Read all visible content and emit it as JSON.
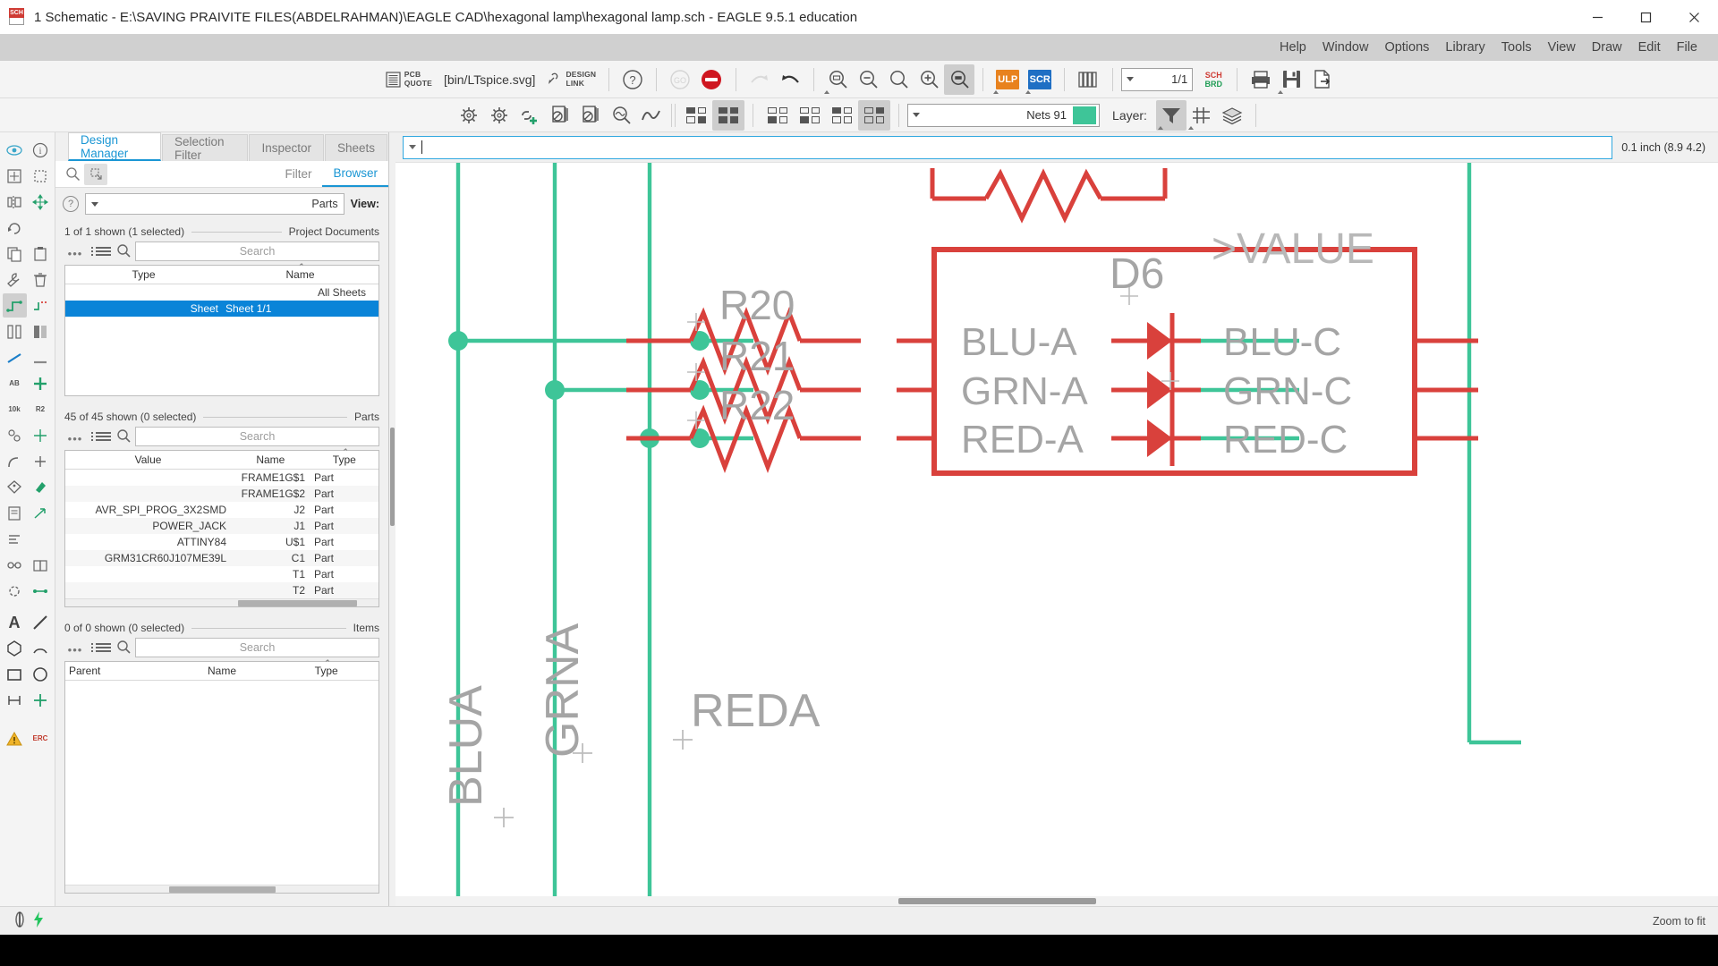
{
  "window": {
    "title": "1 Schematic - E:\\SAVING PRAIVITE FILES(ABDELRAHMAN)\\EAGLE CAD\\hexagonal lamp\\hexagonal lamp.sch - EAGLE 9.5.1 education",
    "app_icon_label": "SCH",
    "minimize": "—",
    "maximize": "❑",
    "close": "✕"
  },
  "menubar": {
    "items": [
      {
        "label": "Help"
      },
      {
        "label": "Window"
      },
      {
        "label": "Options"
      },
      {
        "label": "Library"
      },
      {
        "label": "Tools"
      },
      {
        "label": "View"
      },
      {
        "label": "Draw"
      },
      {
        "label": "Edit"
      },
      {
        "label": "File"
      }
    ]
  },
  "toolbar_primary": {
    "pcb_quote_line1": "PCB",
    "pcb_quote_line2": "QUOTE",
    "ltspice_label": "[bin/LTspice.svg]",
    "design_link_line1": "DESIGN",
    "design_link_line2": "LINK",
    "help_label": "?",
    "ulp_label": "ULP",
    "scr_label": "SCR",
    "sheet_value": "1/1",
    "sch_label": "SCH",
    "brd_label": "BRD"
  },
  "toolbar_secondary": {
    "net_name": "Nets 91",
    "net_color": "#3ec598",
    "layer_label": "Layer:"
  },
  "panel": {
    "tabs": [
      {
        "label": "Design Manager",
        "active": true
      },
      {
        "label": "Selection Filter",
        "active": false
      },
      {
        "label": "Inspector",
        "active": false
      },
      {
        "label": "Sheets",
        "active": false
      }
    ],
    "subtabs": [
      {
        "label": "Filter",
        "active": false
      },
      {
        "label": "Browser",
        "active": true
      }
    ],
    "filter_combo_value": "Parts",
    "view_label": "View:",
    "sections": [
      {
        "id": "documents",
        "count_label": "1 of 1 shown (1 selected)",
        "title": "Project Documents",
        "search_placeholder": "Search",
        "columns": [
          "Type",
          "Name"
        ],
        "subheader": "All Sheets",
        "rows": [
          {
            "type": "Sheet",
            "name": "Sheet 1/1",
            "selected": true
          }
        ]
      },
      {
        "id": "parts",
        "count_label": "45 of 45 shown (0 selected)",
        "title": "Parts",
        "search_placeholder": "Search",
        "columns": [
          "Value",
          "Name",
          "Type"
        ],
        "rows": [
          {
            "value": "",
            "name": "FRAME1G$1",
            "type": "Part"
          },
          {
            "value": "",
            "name": "FRAME1G$2",
            "type": "Part"
          },
          {
            "value": "AVR_SPI_PROG_3X2SMD",
            "name": "J2",
            "type": "Part"
          },
          {
            "value": "POWER_JACK",
            "name": "J1",
            "type": "Part"
          },
          {
            "value": "ATTINY84",
            "name": "U$1",
            "type": "Part"
          },
          {
            "value": "GRM31CR60J107ME39L",
            "name": "C1",
            "type": "Part"
          },
          {
            "value": "",
            "name": "T1",
            "type": "Part"
          },
          {
            "value": "",
            "name": "T2",
            "type": "Part"
          }
        ]
      },
      {
        "id": "items",
        "count_label": "0 of 0 shown (0 selected)",
        "title": "Items",
        "search_placeholder": "Search",
        "columns": [
          "Parent",
          "Name",
          "Type"
        ],
        "rows": []
      }
    ]
  },
  "command": {
    "value": "",
    "coordinate_readout": "0.1 inch (8.9 4.2)"
  },
  "statusbar": {
    "message": "Zoom to fit"
  },
  "schematic": {
    "resistors": [
      {
        "label": "R20"
      },
      {
        "label": "R21"
      },
      {
        "label": "R22"
      }
    ],
    "component": {
      "designator": "D6",
      "value_placeholder": ">VALUE",
      "pins_left": [
        "BLU-A",
        "GRN-A",
        "RED-A"
      ],
      "pins_right": [
        "BLU-C",
        "GRN-C",
        "RED-C"
      ]
    },
    "net_labels": [
      {
        "text": "BLUA",
        "rotated": true
      },
      {
        "text": "GRNA",
        "rotated": true
      },
      {
        "text": "REDA",
        "rotated": false
      }
    ],
    "colors": {
      "wire_red": "#d9413c",
      "wire_green": "#3ec598",
      "text_gray": "#a5a5a5"
    }
  }
}
